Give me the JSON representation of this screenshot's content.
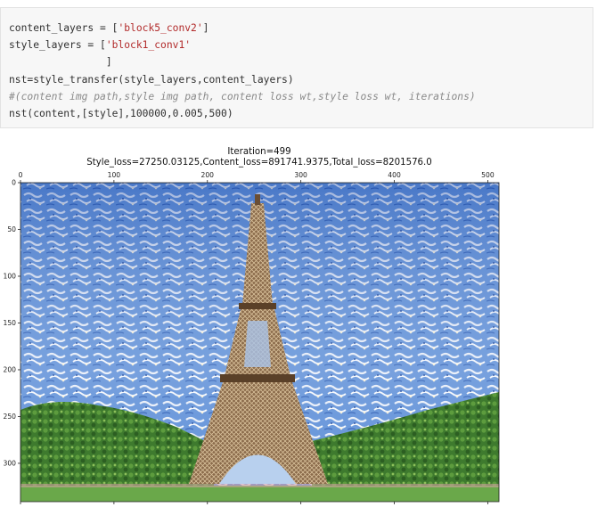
{
  "code_cell": {
    "line1": {
      "a": "content_layers = [",
      "b": "'block5_conv2'",
      "c": "]"
    },
    "line2": {
      "a": "style_layers = [",
      "b": "'block1_conv1'"
    },
    "line3": {
      "a": "                ]"
    },
    "line4": {
      "a": "nst=style_transfer(style_layers,content_layers)"
    },
    "line5": {
      "a": "#(content img path,style img path, content loss wt,style loss wt, iterations)"
    },
    "line6": {
      "a": "nst(content,[style],100000,0.005,500)"
    }
  },
  "plot": {
    "title_line1": "Iteration=499",
    "title_line2": "Style_loss=27250.03125,Content_loss=891741.9375,Total_loss=8201576.0",
    "x_ticks": [
      "0",
      "100",
      "200",
      "300",
      "400",
      "500"
    ],
    "y_ticks": [
      "0",
      "50",
      "100",
      "150",
      "200",
      "250",
      "300"
    ],
    "x_range": [
      0,
      512
    ],
    "y_range": [
      0,
      341
    ],
    "image_subject": "stylized-eiffel-tower",
    "colors": {
      "sky": "#5f90d8",
      "cloud": "#e8eef8",
      "tower": "#8a6a4a",
      "trees": "#3e7a2e",
      "grass": "#6aa84a"
    }
  }
}
